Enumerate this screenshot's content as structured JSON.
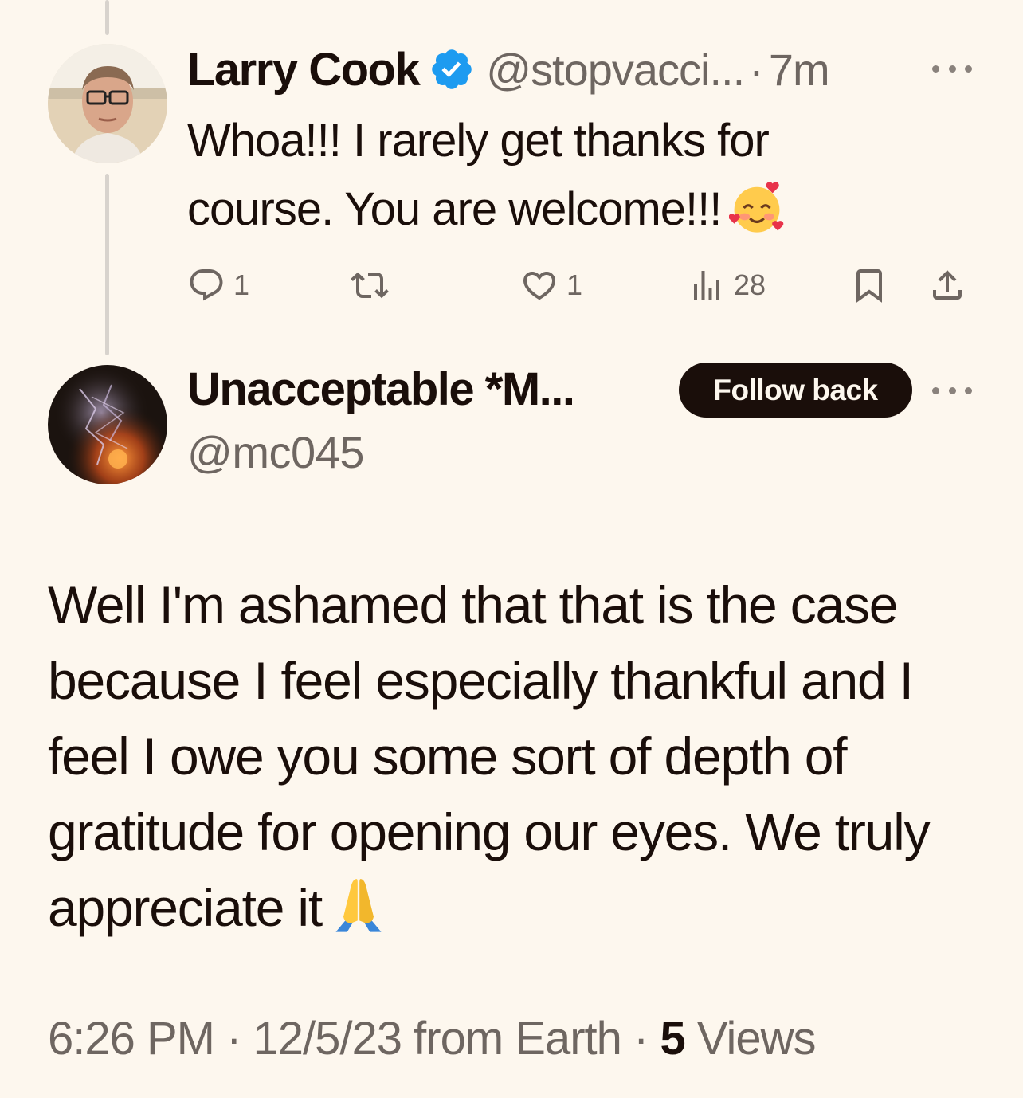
{
  "reply_tweet": {
    "author_name": "Larry Cook",
    "handle": "@stopvacci...",
    "separator": "·",
    "time": "7m",
    "text": "Whoa!!! I rarely get thanks for course. You are welcome!!!",
    "emoji": "smiling-face-with-hearts",
    "verified_color": "#1d9bf0",
    "actions": {
      "replies": "1",
      "retweets": "",
      "likes": "1",
      "views": "28"
    }
  },
  "main_tweet": {
    "author_name": "Unacceptable *M...",
    "handle": "@mc045",
    "follow_label": "Follow back",
    "text": "Well I'm ashamed that that is the case because I feel especially thankful and I feel I owe you some sort of depth of gratitude for opening our eyes. We truly appreciate it",
    "emoji": "folded-hands",
    "meta": {
      "time": "6:26 PM",
      "sep1": " · ",
      "date_source": "12/5/23 from Earth",
      "sep2": " · ",
      "views_count": "5",
      "views_label": " Views"
    }
  },
  "colors": {
    "background": "#fdf7ee",
    "text": "#1a0e0a",
    "secondary": "#6e6661",
    "thread_line": "#d8d3cd"
  }
}
